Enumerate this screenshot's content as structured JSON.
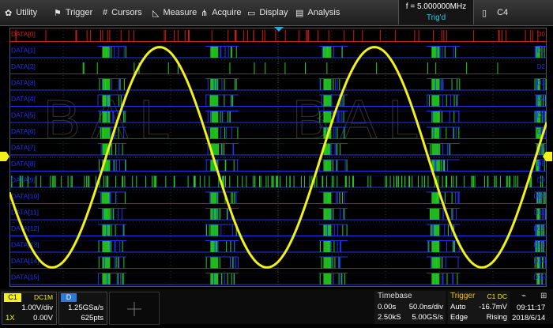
{
  "menu": {
    "utility": "Utility",
    "trigger": "Trigger",
    "cursors": "Cursors",
    "measure": "Measure",
    "acquire": "Acquire",
    "display": "Display",
    "analysis": "Analysis",
    "frequency": "f = 5.000000MHz",
    "trig_status": "Trig'd",
    "channel": "C4"
  },
  "digital": {
    "d0_label": "DATA[0]",
    "d0_tag": "D0",
    "labels": [
      "DATA[1]",
      "DATA[2]",
      "DATA[3]",
      "DATA[4]",
      "DATA[5]",
      "DATA[6]",
      "DATA[7]",
      "DATA[8]",
      "DATA[9]",
      "DATA[10]",
      "DATA[11]",
      "DATA[12]",
      "DATA[13]",
      "DATA[14]",
      "DATA[15]"
    ],
    "tags": [
      "D1",
      "D2",
      "D3",
      "D4",
      "D5",
      "D6",
      "D7",
      "D8",
      "D9",
      "D10",
      "D11",
      "D12",
      "D13",
      "D14",
      "D15"
    ]
  },
  "watermark": "BAL",
  "colors": {
    "d0": "#c81e1e",
    "digital": "#2233ee",
    "active": "#22cc22",
    "c1": "#f2f21a",
    "accent": "#29c8e8",
    "trigger_label": "#f0c020"
  },
  "channel1": {
    "label": "C1",
    "coupling": "DC1M",
    "scale": "1.00V/div",
    "probe": "1X",
    "offset": "0.00V"
  },
  "digital_info": {
    "label": "D",
    "sample_rate": "1.25GSa/s",
    "points": "625pts"
  },
  "timebase": {
    "title": "Timebase",
    "delay": "0.00s",
    "scale": "50.0ns/div",
    "memory": "2.50kS",
    "sample_rate": "5.00GS/s"
  },
  "trigger": {
    "title": "Trigger",
    "source": "C1 DC",
    "mode": "Auto",
    "level": "-16.7mV",
    "type": "Edge",
    "slope": "Rising"
  },
  "clock": {
    "time": "09:11:17",
    "date": "2018/6/14"
  }
}
